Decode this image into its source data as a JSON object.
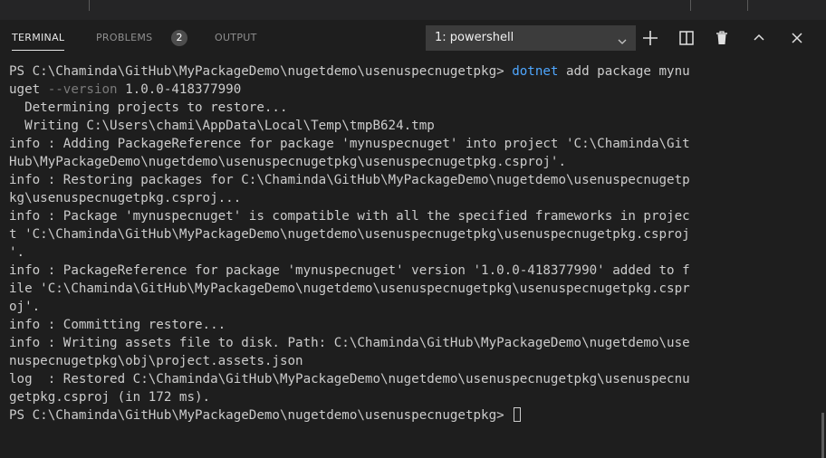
{
  "panel": {
    "tabs": {
      "terminal": "TERMINAL",
      "problems": "PROBLEMS",
      "problems_count": "2",
      "output": "OUTPUT"
    },
    "terminal_selector": "1: powershell",
    "icons": [
      "chevron-down-icon",
      "plus-icon",
      "split-icon",
      "trash-icon",
      "chevron-up-icon",
      "close-icon"
    ]
  },
  "terminal": {
    "lines": [
      [
        {
          "t": "PS C:\\Chaminda\\GitHub\\MyPackageDemo\\nugetdemo\\usenuspecnugetpkg> "
        },
        {
          "t": "dotnet",
          "c": "kw"
        },
        {
          "t": " add package mynu"
        }
      ],
      [
        {
          "t": "uget "
        },
        {
          "t": "--version",
          "c": "dim"
        },
        {
          "t": " 1.0.0-418377990"
        }
      ],
      [
        {
          "t": "  Determining projects to restore..."
        }
      ],
      [
        {
          "t": "  Writing C:\\Users\\chami\\AppData\\Local\\Temp\\tmpB624.tmp"
        }
      ],
      [
        {
          "t": "info : Adding PackageReference for package 'mynuspecnuget' into project 'C:\\Chaminda\\Git"
        }
      ],
      [
        {
          "t": "Hub\\MyPackageDemo\\nugetdemo\\usenuspecnugetpkg\\usenuspecnugetpkg.csproj'."
        }
      ],
      [
        {
          "t": "info : Restoring packages for C:\\Chaminda\\GitHub\\MyPackageDemo\\nugetdemo\\usenuspecnugetp"
        }
      ],
      [
        {
          "t": "kg\\usenuspecnugetpkg.csproj..."
        }
      ],
      [
        {
          "t": "info : Package 'mynuspecnuget' is compatible with all the specified frameworks in projec"
        }
      ],
      [
        {
          "t": "t 'C:\\Chaminda\\GitHub\\MyPackageDemo\\nugetdemo\\usenuspecnugetpkg\\usenuspecnugetpkg.csproj"
        }
      ],
      [
        {
          "t": "'."
        }
      ],
      [
        {
          "t": "info : PackageReference for package 'mynuspecnuget' version '1.0.0-418377990' added to f"
        }
      ],
      [
        {
          "t": "ile 'C:\\Chaminda\\GitHub\\MyPackageDemo\\nugetdemo\\usenuspecnugetpkg\\usenuspecnugetpkg.cspr"
        }
      ],
      [
        {
          "t": "oj'."
        }
      ],
      [
        {
          "t": "info : Committing restore..."
        }
      ],
      [
        {
          "t": "info : Writing assets file to disk. Path: C:\\Chaminda\\GitHub\\MyPackageDemo\\nugetdemo\\use"
        }
      ],
      [
        {
          "t": "nuspecnugetpkg\\obj\\project.assets.json"
        }
      ],
      [
        {
          "t": "log  : Restored C:\\Chaminda\\GitHub\\MyPackageDemo\\nugetdemo\\usenuspecnugetpkg\\usenuspecnu"
        }
      ],
      [
        {
          "t": "getpkg.csproj (in 172 ms)."
        }
      ],
      [
        {
          "t": "PS C:\\Chaminda\\GitHub\\MyPackageDemo\\nugetdemo\\usenuspecnugetpkg> "
        },
        {
          "cursor": true
        }
      ]
    ]
  },
  "colors": {
    "background": "#1e1e1e",
    "text": "#cccccc",
    "command": "#4fa7ff",
    "flag": "#7a7a7a"
  }
}
